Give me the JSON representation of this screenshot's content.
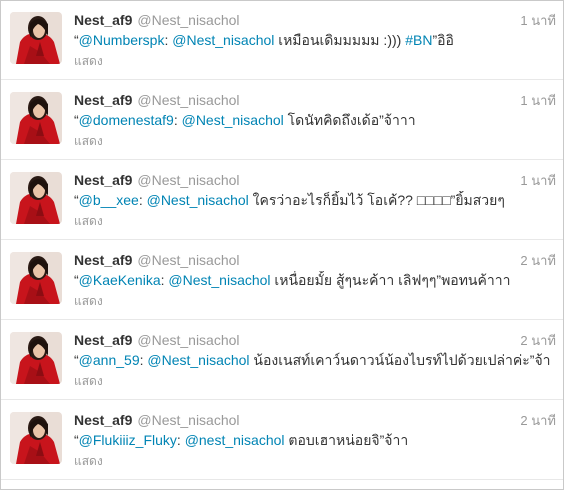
{
  "tweets": [
    {
      "name": "Nest_af9",
      "handle": "@Nest_nisachol",
      "time": "1 นาที",
      "text_parts": [
        {
          "t": "“",
          "link": false
        },
        {
          "t": "@Numberspk",
          "link": true
        },
        {
          "t": ": ",
          "link": false
        },
        {
          "t": "@Nest_nisachol",
          "link": true
        },
        {
          "t": " เหมือนเดิมมมมม :))) ",
          "link": false
        },
        {
          "t": "#BN",
          "link": true
        },
        {
          "t": "”อิอิ",
          "link": false
        }
      ],
      "expand": "แสดง"
    },
    {
      "name": "Nest_af9",
      "handle": "@Nest_nisachol",
      "time": "1 นาที",
      "text_parts": [
        {
          "t": "“",
          "link": false
        },
        {
          "t": "@domenestaf9",
          "link": true
        },
        {
          "t": ": ",
          "link": false
        },
        {
          "t": "@Nest_nisachol",
          "link": true
        },
        {
          "t": " โดนัทคิดถึงเด้อ”จ้าาา",
          "link": false
        }
      ],
      "expand": "แสดง"
    },
    {
      "name": "Nest_af9",
      "handle": "@Nest_nisachol",
      "time": "1 นาที",
      "text_parts": [
        {
          "t": "“",
          "link": false
        },
        {
          "t": "@b__xee",
          "link": true
        },
        {
          "t": ": ",
          "link": false
        },
        {
          "t": "@Nest_nisachol",
          "link": true
        },
        {
          "t": " ใครว่าอะไรก็ยิ้มไว้ โอเค้?? □□□□”ยิ้มสวยๆ",
          "link": false
        }
      ],
      "expand": "แสดง"
    },
    {
      "name": "Nest_af9",
      "handle": "@Nest_nisachol",
      "time": "2 นาที",
      "text_parts": [
        {
          "t": "“",
          "link": false
        },
        {
          "t": "@KaeKenika",
          "link": true
        },
        {
          "t": ": ",
          "link": false
        },
        {
          "t": "@Nest_nisachol",
          "link": true
        },
        {
          "t": " เหนื่อยมั้ย สู้ๆนะค้าา เลิฟๆๆ”พอทนค้าาา",
          "link": false
        }
      ],
      "expand": "แสดง"
    },
    {
      "name": "Nest_af9",
      "handle": "@Nest_nisachol",
      "time": "2 นาที",
      "text_parts": [
        {
          "t": "“",
          "link": false
        },
        {
          "t": "@ann_59",
          "link": true
        },
        {
          "t": ": ",
          "link": false
        },
        {
          "t": "@Nest_nisachol",
          "link": true
        },
        {
          "t": " น้องเนสท์เคาว์นดาวน์น้องไบรท์ไปด้วยเปล่าค่ะ”จ้า",
          "link": false
        }
      ],
      "expand": "แสดง"
    },
    {
      "name": "Nest_af9",
      "handle": "@Nest_nisachol",
      "time": "2 นาที",
      "text_parts": [
        {
          "t": "“",
          "link": false
        },
        {
          "t": "@Flukiiiz_Fluky",
          "link": true
        },
        {
          "t": ": ",
          "link": false
        },
        {
          "t": "@nest_nisachol",
          "link": true
        },
        {
          "t": " ตอบเฮาหน่อยจิ”จ้าา",
          "link": false
        }
      ],
      "expand": "แสดง"
    }
  ],
  "colors": {
    "link": "#0084b4",
    "name": "#333333",
    "meta": "#999999",
    "avatar_red": "#c8141c"
  },
  "icons": {
    "avatar": "profile-photo"
  }
}
